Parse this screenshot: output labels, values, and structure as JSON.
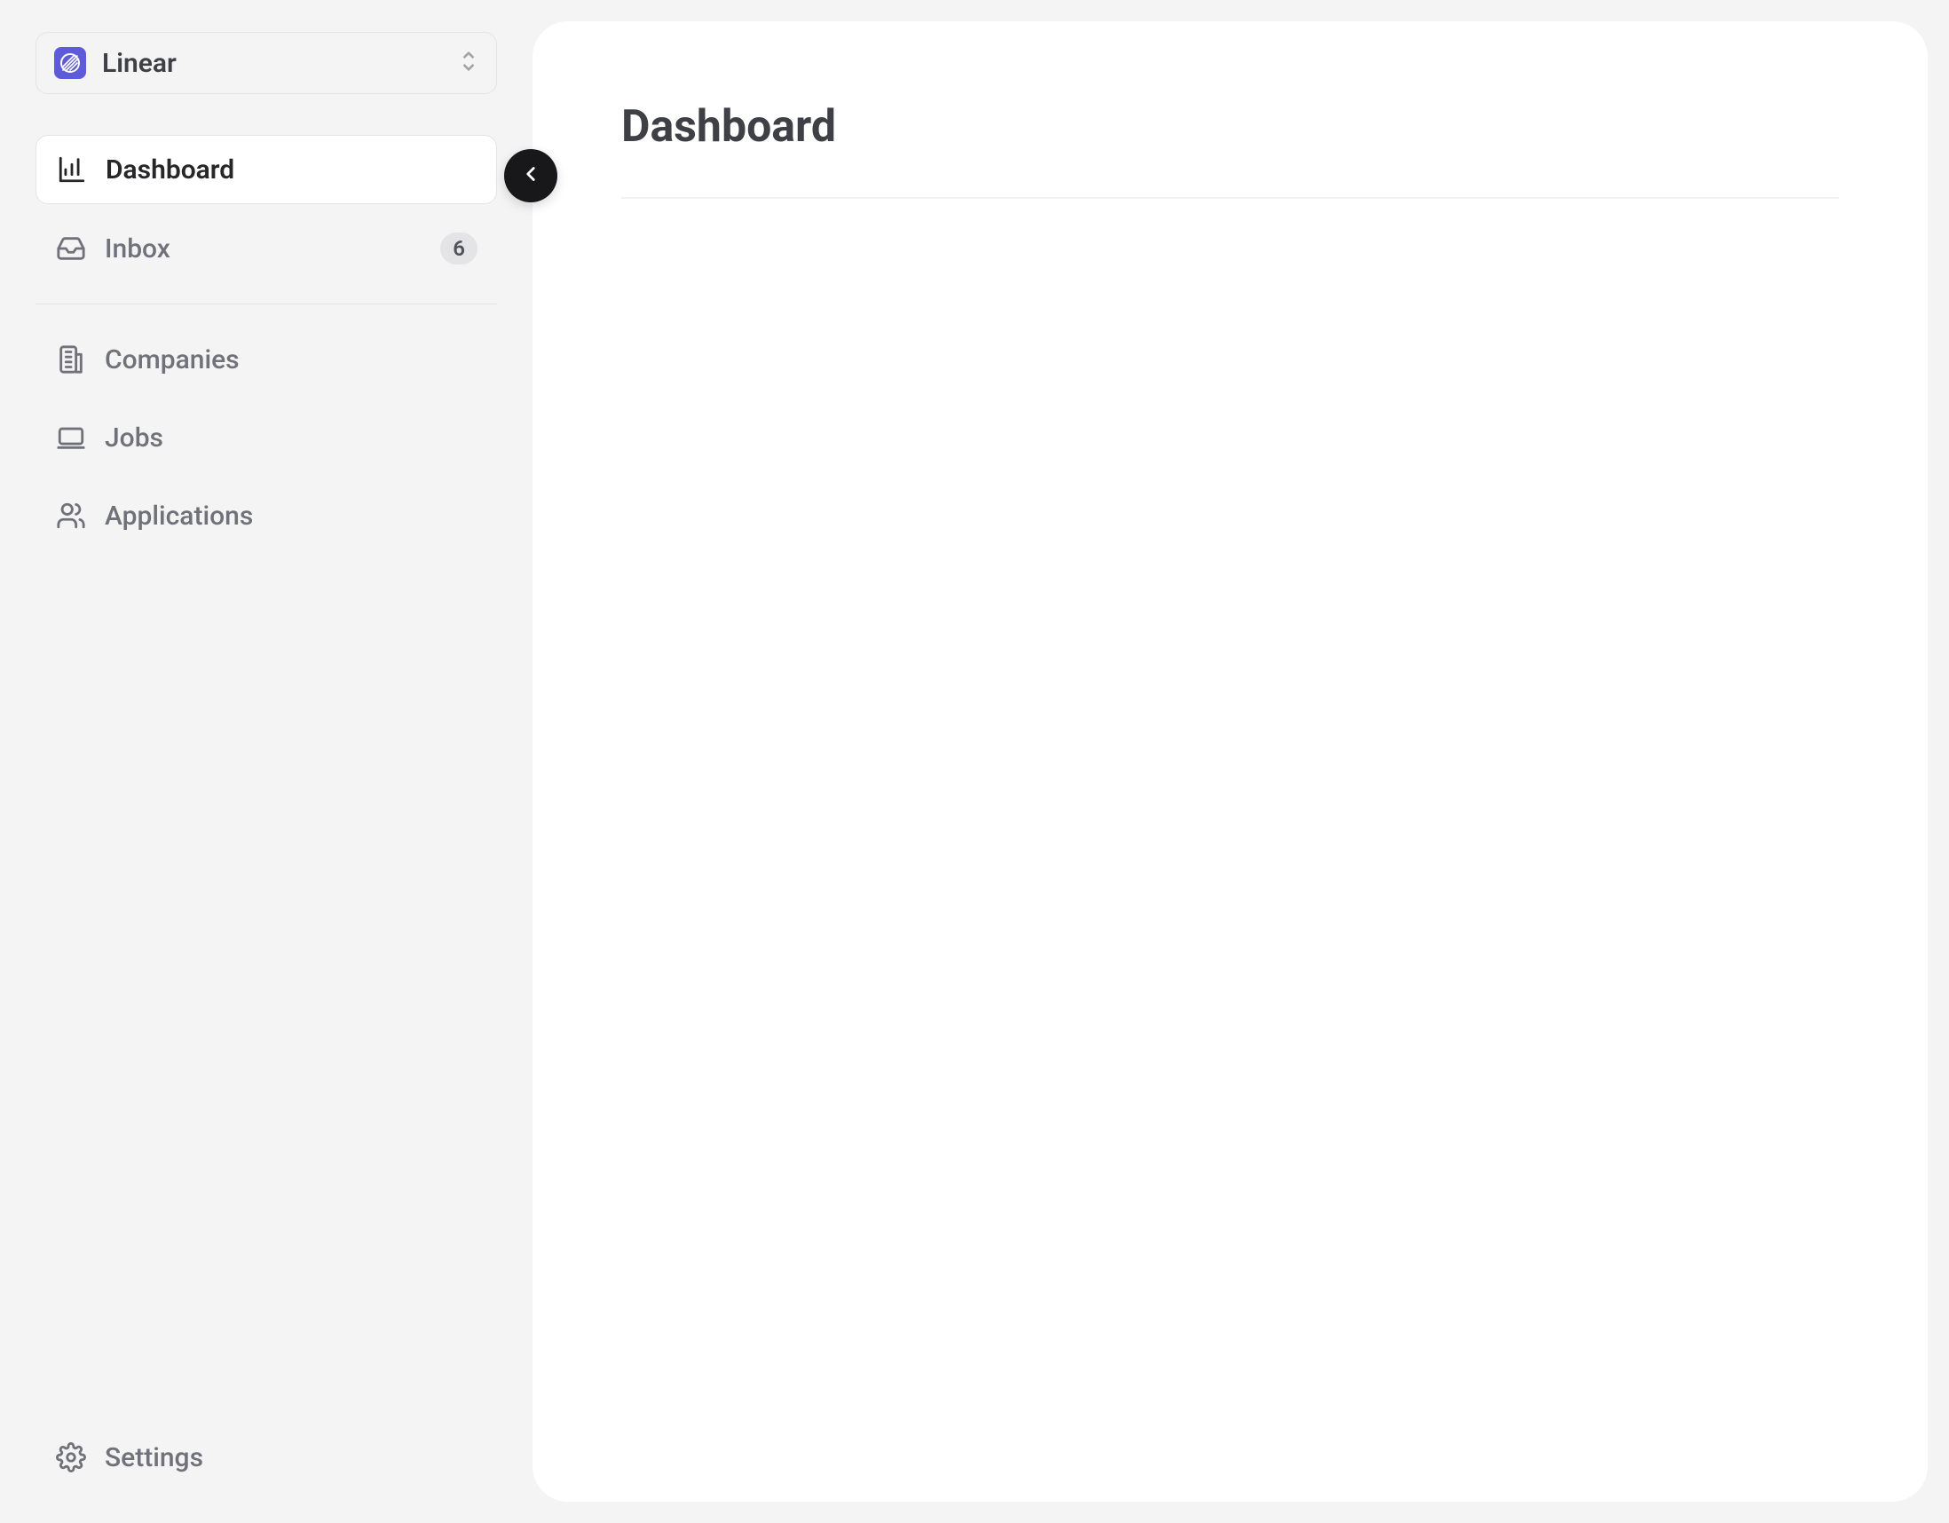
{
  "workspace": {
    "name": "Linear"
  },
  "sidebar": {
    "primary": [
      {
        "label": "Dashboard",
        "active": true
      },
      {
        "label": "Inbox",
        "badge": "6"
      }
    ],
    "secondary": [
      {
        "label": "Companies"
      },
      {
        "label": "Jobs"
      },
      {
        "label": "Applications"
      }
    ],
    "footer": {
      "settings_label": "Settings"
    }
  },
  "main": {
    "title": "Dashboard"
  }
}
